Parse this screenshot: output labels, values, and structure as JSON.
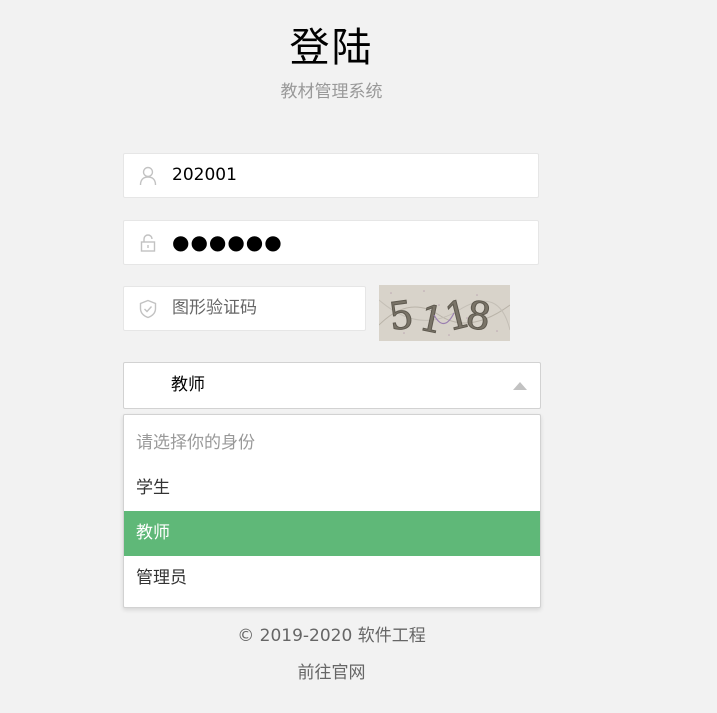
{
  "header": {
    "title": "登陆",
    "subtitle": "教材管理系统"
  },
  "form": {
    "username": {
      "value": "202001",
      "icon": "user-icon"
    },
    "password": {
      "value": "●●●●●●",
      "icon": "lock-icon"
    },
    "captcha": {
      "placeholder": "图形验证码",
      "icon": "shield-icon",
      "image_text": "5118"
    },
    "role": {
      "selected": "教师",
      "placeholder": "请选择你的身份",
      "options": [
        "学生",
        "教师",
        "管理员"
      ]
    }
  },
  "footer": {
    "copyright": "© 2019-2020 软件工程",
    "link": "前往官网"
  },
  "colors": {
    "background": "#f2f2f2",
    "accent": "#5fb878",
    "muted_text": "#999999"
  }
}
